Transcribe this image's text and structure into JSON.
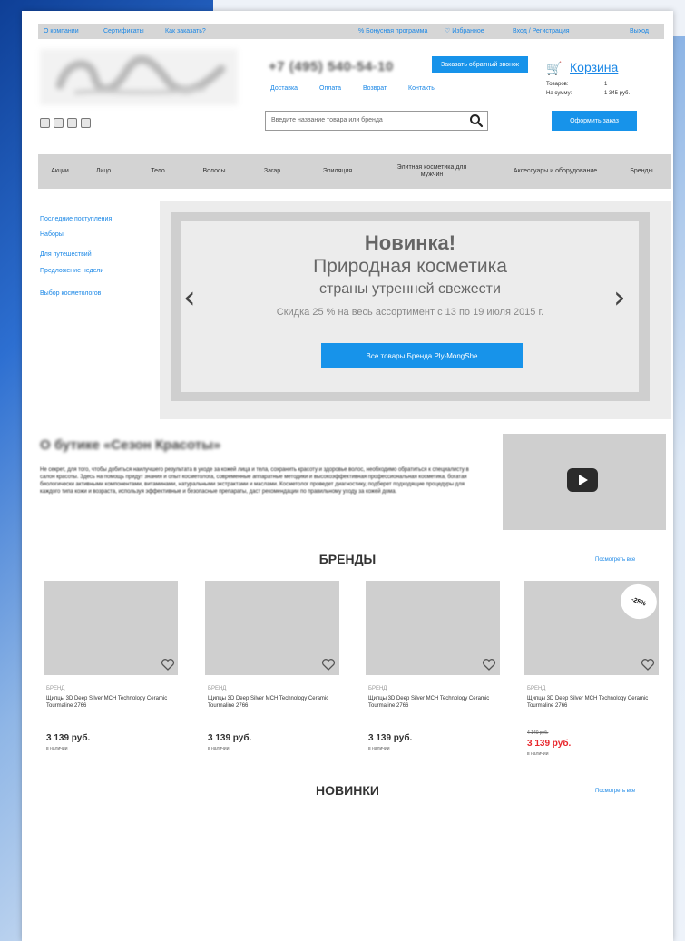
{
  "topbar": {
    "about": "О компании",
    "certificates": "Сертификаты",
    "how_to_order": "Как заказать?",
    "bonus": "% Бонусная программа",
    "favorites": "♡ Избранное",
    "login": "Вход / Регистрация",
    "exit": "Выход"
  },
  "header": {
    "phone": "+7 (495) 540-54-10",
    "callback_button": "Заказать обратный звонок",
    "nav": [
      "Доставка",
      "Оплата",
      "Возврат",
      "Контакты"
    ],
    "search_placeholder": "Введите название товара или бренда",
    "cart": {
      "label": "Корзина",
      "items_label": "Товаров:",
      "items_value": "1",
      "sum_label": "На сумму:",
      "sum_value": "1 345 руб."
    },
    "checkout_button": "Оформить заказ"
  },
  "menu": [
    "Акции",
    "Лицо",
    "Тело",
    "Волосы",
    "Загар",
    "Эпиляция",
    "Элитная косметика для мужчин",
    "Аксессуары и оборудование",
    "Бренды"
  ],
  "sidebar": [
    "Последние поступления",
    "Наборы",
    "Для путешествий",
    "Предложение недели",
    "Выбор косметологов"
  ],
  "banner": {
    "title": "Новинка!",
    "subtitle": "Природная косметика",
    "subtitle2": "страны утренней свежести",
    "discount": "Скидка 25 % на весь ассортимент с 13 по 19 июля 2015 г.",
    "button": "Все товары Бренда Ply-MongShe"
  },
  "about": {
    "title": "О бутике «Сезон Красоты»",
    "text": "Не секрет, для того, чтобы добиться наилучшего результата в уходе за кожей лица и тела, сохранить красоту и здоровье волос, необходимо обратиться к специалисту в салон красоты. Здесь на помощь придут знания и опыт косметолога, современные аппаратные методики и высокоэффективная профессиональная косметика, богатая биологически активными компонентами, витаминами, натуральными экстрактами и маслами. Косметолог проведет диагностику, подберет подходящие процедуры для каждого типа кожи и возраста, используя эффективные и безопасные препараты, даст рекомендации по правильному уходу за кожей дома."
  },
  "brands": {
    "title": "БРЕНДЫ",
    "see_all": "Посмотреть все",
    "badge": "-25%",
    "products": [
      {
        "brand": "БРЕНД",
        "name": "Щипцы 3D Deep Silver MCH Technology Ceramic Tourmaline 2766",
        "price": "3 139 руб.",
        "stock": "в наличии"
      },
      {
        "brand": "БРЕНД",
        "name": "Щипцы 3D Deep Silver MCH Technology Ceramic Tourmaline 2766",
        "price": "3 139 руб.",
        "stock": "в наличии"
      },
      {
        "brand": "БРЕНД",
        "name": "Щипцы 3D Deep Silver MCH Technology Ceramic Tourmaline 2766",
        "price": "3 139 руб.",
        "stock": "в наличии"
      },
      {
        "brand": "БРЕНД",
        "name": "Щипцы 3D Deep Silver MCH Technology Ceramic Tourmaline 2766",
        "old_price": "4 140 руб.",
        "price": "3 139 руб.",
        "stock": "в наличии"
      }
    ]
  },
  "new": {
    "title": "НОВИНКИ",
    "see_all": "Посмотреть все"
  },
  "colors": {
    "accent": "#1793ea",
    "sale": "#e8282d",
    "cart_icon": "#d9248a"
  },
  "icons": [
    "cart-icon",
    "search-icon",
    "heart-icon",
    "play-icon",
    "chevron-left-icon",
    "chevron-right-icon",
    "social-icon"
  ]
}
